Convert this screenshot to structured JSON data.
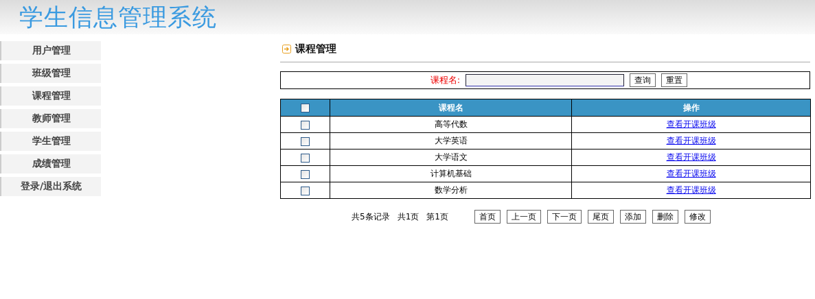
{
  "header": {
    "title": "学生信息管理系统"
  },
  "sidebar": {
    "items": [
      {
        "label": "用户管理"
      },
      {
        "label": "班级管理"
      },
      {
        "label": "课程管理"
      },
      {
        "label": "教师管理"
      },
      {
        "label": "学生管理"
      },
      {
        "label": "成绩管理"
      },
      {
        "label": "登录/退出系统"
      }
    ]
  },
  "page_title": "课程管理",
  "search": {
    "label": "课程名:",
    "buttons": [
      "查询",
      "重置"
    ]
  },
  "table": {
    "header_checked": false,
    "columns": [
      "课程名",
      "操作"
    ],
    "rows": [
      {
        "checked": false,
        "name": "高等代数",
        "action": "查看开课班级"
      },
      {
        "checked": false,
        "name": "大学英语",
        "action": "查看开课班级"
      },
      {
        "checked": false,
        "name": "大学语文",
        "action": "查看开课班级"
      },
      {
        "checked": false,
        "name": "计算机基础",
        "action": "查看开课班级"
      },
      {
        "checked": false,
        "name": "数学分析",
        "action": "查看开课班级"
      }
    ]
  },
  "pagination": {
    "info": [
      "共5条记录",
      "共1页",
      "第1页"
    ],
    "buttons": [
      "首页",
      "上一页",
      "下一页",
      "尾页",
      "添加",
      "删除",
      "修改"
    ]
  }
}
